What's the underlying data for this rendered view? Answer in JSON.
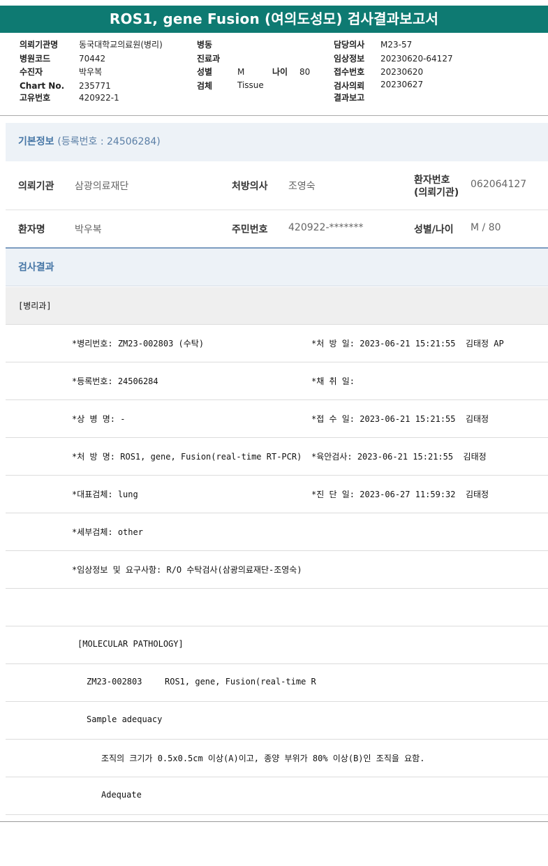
{
  "report": {
    "title": "ROS1, gene Fusion (여의도성모) 검사결과보고서"
  },
  "header": {
    "col1": [
      {
        "label": "의뢰기관명",
        "value": "동국대학교의료원(병리)"
      },
      {
        "label": "병원코드",
        "value": "70442"
      },
      {
        "label": "수진자",
        "value": "박우복"
      },
      {
        "label": "Chart No.",
        "value": "235771"
      },
      {
        "label": "고유번호",
        "value": "420922-1"
      }
    ],
    "col2": [
      {
        "label": "병동",
        "value": ""
      },
      {
        "label": "진료과",
        "value": ""
      },
      {
        "label": "성별",
        "value": "M"
      },
      {
        "label": "검체",
        "value": "Tissue"
      }
    ],
    "age": {
      "label": "나이",
      "value": "80"
    },
    "col3": [
      {
        "label": "담당의사",
        "value": ""
      },
      {
        "label": "임상정보",
        "value": "M23-57"
      },
      {
        "label": "접수번호",
        "value": "20230620-64127"
      },
      {
        "label": "검사의뢰",
        "value": "20230620"
      },
      {
        "label": "결과보고",
        "value": "20230627"
      }
    ]
  },
  "basic": {
    "title": "기본정보",
    "reg": "(등록번호 : 24506284)",
    "row1": [
      {
        "label": "의뢰기관",
        "value": "삼광의료재단"
      },
      {
        "label": "처방의사",
        "value": "조영숙"
      },
      {
        "label": "환자번호",
        "label2": "(의뢰기관)",
        "value": "062064127"
      }
    ],
    "row2": [
      {
        "label": "환자명",
        "value": "박우복"
      },
      {
        "label": "주민번호",
        "value": "420922-*******"
      },
      {
        "label": "성별/나이",
        "value": "M / 80"
      }
    ]
  },
  "results": {
    "title": "검사결과",
    "dept": "[병리과]",
    "lines": [
      {
        "left": "*병리번호: ZM23-002803 (수탁)",
        "right": "*처 방 일: 2023-06-21 15:21:55  김태정 AP"
      },
      {
        "left": "*등록번호: 24506284",
        "right": "*채 취 일:"
      },
      {
        "left": "*상 병 명: -",
        "right": "*접 수 일: 2023-06-21 15:21:55  김태정"
      },
      {
        "left": "*처 방 명: ROS1, gene, Fusion(real-time RT-PCR)",
        "right": "*육안검사: 2023-06-21 15:21:55  김태정"
      },
      {
        "left": "*대표검체: lung",
        "right": "*진 단 일: 2023-06-27 11:59:32  김태정"
      },
      {
        "left": "*세부검체: other",
        "right": ""
      },
      {
        "left": "*임상정보 및 요구사항: R/O 수탁검사(삼광의료재단-조영숙)",
        "right": ""
      }
    ],
    "molecular": "[MOLECULAR PATHOLOGY]",
    "code": "ZM23-002803",
    "test": "ROS1, gene, Fusion(real-time R",
    "sample": "Sample adequacy",
    "criteria": "조직의 크기가 0.5x0.5cm 이상(A)이고, 종양 부위가 80% 이상(B)인 조직을 요함.",
    "adequate": "Adequate"
  }
}
